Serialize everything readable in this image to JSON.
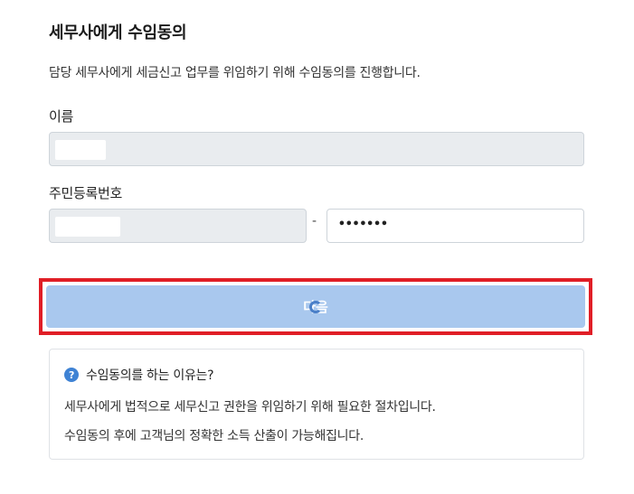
{
  "header": {
    "title": "세무사에게 수임동의",
    "description": "담당 세무사에게 세금신고 업무를 위임하기 위해 수임동의를 진행합니다."
  },
  "form": {
    "name_label": "이름",
    "rrn_label": "주민등록번호",
    "rrn_separator": "-",
    "rrn_back_value": "•••••••"
  },
  "next_button": {
    "label": "다음"
  },
  "info": {
    "icon": "question-circle-icon",
    "heading": "수임동의를 하는 이유는?",
    "line1": "세무사에게 법적으로 세무신고 권한을 위임하기 위해 필요한 절차입니다.",
    "line2": "수임동의 후에 고객님의 정확한 소득 산출이 가능해집니다."
  },
  "colors": {
    "button": "#a9c8ee",
    "highlight_border": "#e01e26",
    "info_icon": "#3e82d4"
  }
}
